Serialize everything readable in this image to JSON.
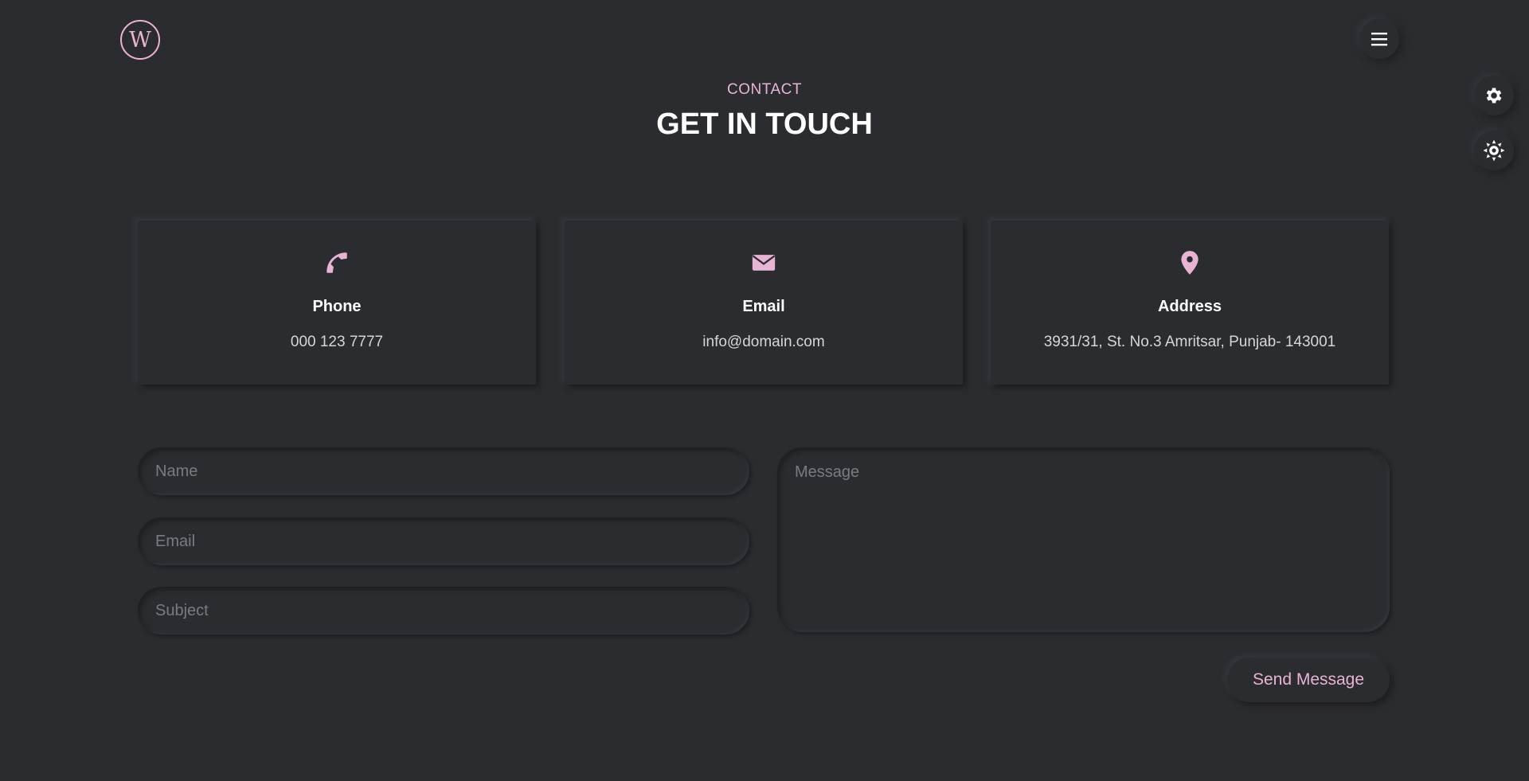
{
  "header": {
    "logo_letter": "W",
    "menu_icon": "hamburger-menu-icon"
  },
  "side_controls": {
    "settings_icon": "gear-icon",
    "theme_icon": "sun-icon"
  },
  "section": {
    "eyebrow": "CONTACT",
    "title": "GET IN TOUCH"
  },
  "cards": [
    {
      "icon": "phone-icon",
      "label": "Phone",
      "value": "000 123 7777"
    },
    {
      "icon": "envelope-icon",
      "label": "Email",
      "value": "info@domain.com"
    },
    {
      "icon": "map-pin-icon",
      "label": "Address",
      "value": "3931/31, St. No.3 Amritsar, Punjab- 143001"
    }
  ],
  "form": {
    "name_placeholder": "Name",
    "email_placeholder": "Email",
    "subject_placeholder": "Subject",
    "message_placeholder": "Message",
    "send_label": "Send Message"
  },
  "colors": {
    "background": "#2b2c30",
    "accent": "#e8b4d4",
    "text": "#ffffff",
    "muted_text": "#d6d6d8",
    "placeholder": "#7a7b80"
  }
}
